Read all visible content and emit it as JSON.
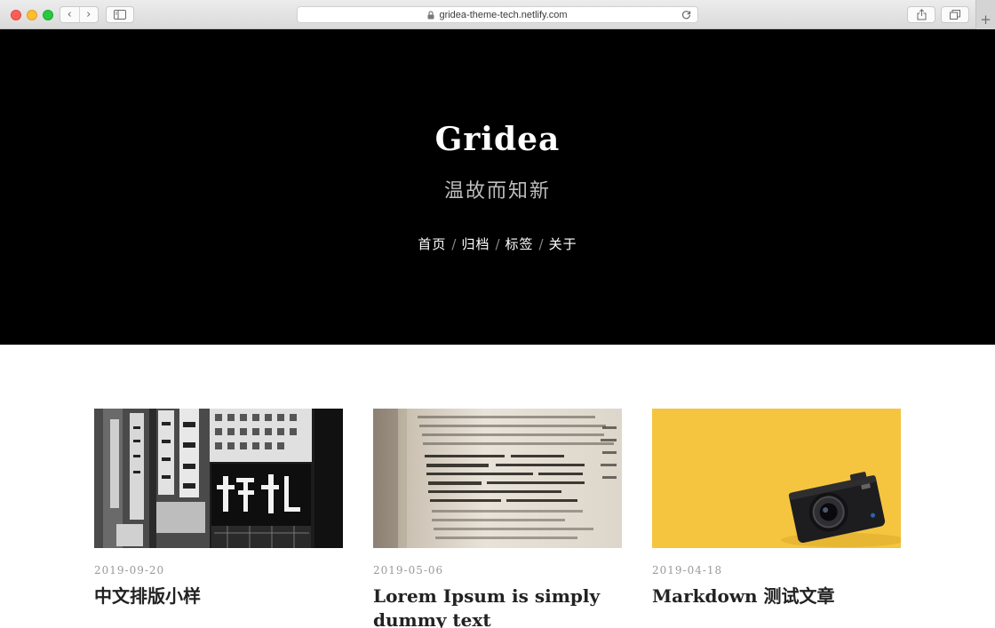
{
  "browser": {
    "url": "gridea-theme-tech.netlify.com",
    "back_glyph": "‹",
    "forward_glyph": "›",
    "new_tab_glyph": "+"
  },
  "site": {
    "title": "Gridea",
    "description": "温故而知新",
    "nav": [
      {
        "label": "首页"
      },
      {
        "label": "归档"
      },
      {
        "label": "标签"
      },
      {
        "label": "关于"
      }
    ],
    "nav_separator": "/"
  },
  "posts": [
    {
      "date": "2019-09-20",
      "title": "中文排版小样",
      "image": "signboard-photo"
    },
    {
      "date": "2019-05-06",
      "title": "Lorem Ipsum is simply dummy text",
      "image": "dictionary-photo"
    },
    {
      "date": "2019-04-18",
      "title": "Markdown 测试文章",
      "image": "camera-photo"
    }
  ],
  "colors": {
    "hero_background": "#000000",
    "hero_title": "#ffffff",
    "hero_description": "#bdbdbd",
    "post_date": "#999999",
    "post_title": "#222222",
    "camera_background": "#f5c53f"
  }
}
